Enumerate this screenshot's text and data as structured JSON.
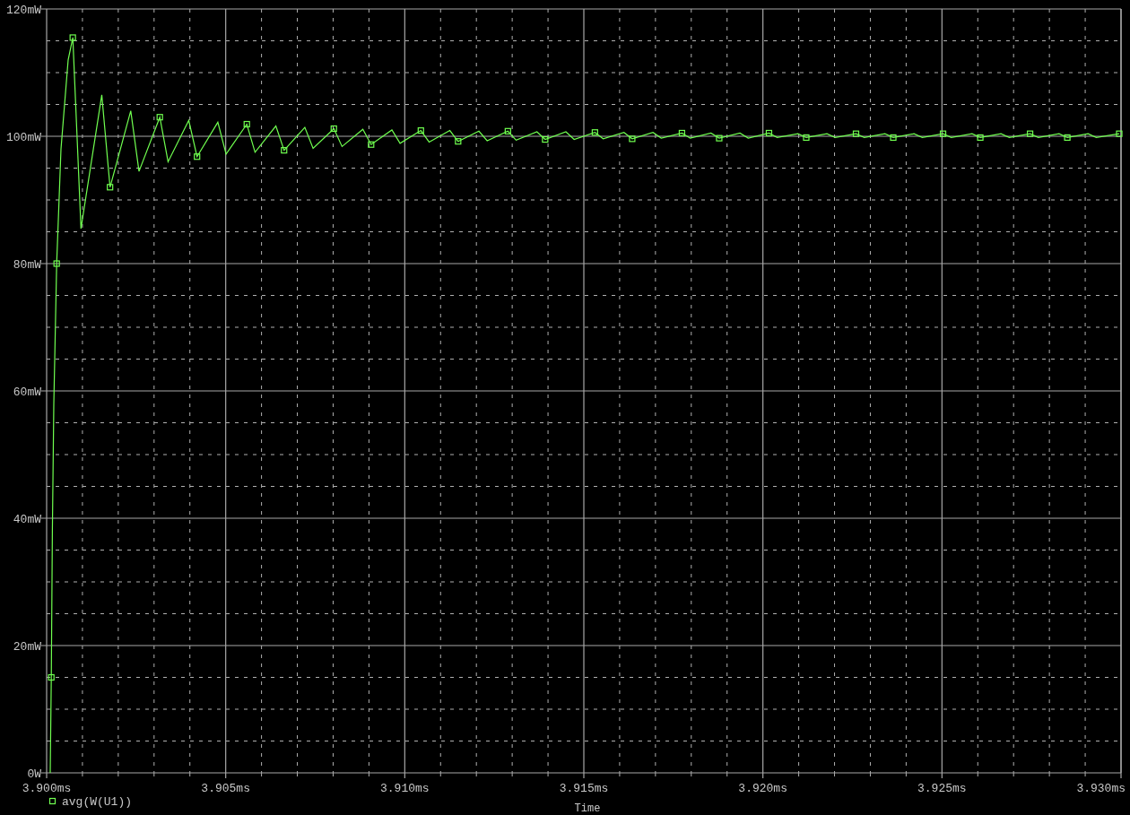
{
  "plot": {
    "chart_data": {
      "type": "line",
      "xlabel": "Time",
      "x": [
        3.9001,
        3.90013,
        3.90016,
        3.9002,
        3.90028,
        3.9004,
        3.9006,
        3.90073,
        3.90096,
        3.90154,
        3.90177,
        3.90235,
        3.90258,
        3.90316,
        3.90339,
        3.90397,
        3.9042,
        3.90478,
        3.90501,
        3.90559,
        3.90582,
        3.9064,
        3.90663,
        3.90721,
        3.90744,
        3.90802,
        3.90825,
        3.90883,
        3.90906,
        3.90964,
        3.90987,
        3.91045,
        3.91068,
        3.91126,
        3.91149,
        3.91207,
        3.9123,
        3.91288,
        3.91311,
        3.91369,
        3.91392,
        3.9145,
        3.91473,
        3.91531,
        3.91554,
        3.91612,
        3.91635,
        3.91693,
        3.91716,
        3.91774,
        3.91797,
        3.91855,
        3.91878,
        3.91936,
        3.91959,
        3.92017,
        3.9204,
        3.92098,
        3.92121,
        3.92179,
        3.92202,
        3.9226,
        3.92283,
        3.92341,
        3.92364,
        3.92422,
        3.92445,
        3.92503,
        3.92526,
        3.92584,
        3.92607,
        3.92665,
        3.92688,
        3.92746,
        3.92769,
        3.92827,
        3.9285,
        3.92908,
        3.92931,
        3.92995
      ],
      "series": [
        {
          "name": "avg(W(U1))",
          "color": "#70ff50",
          "values": [
            0,
            15,
            38,
            58,
            80,
            98,
            112,
            115.5,
            85.5,
            106.5,
            92,
            104,
            94.5,
            103,
            96,
            102.5,
            96.8,
            102.2,
            97.2,
            101.9,
            97.5,
            101.6,
            97.8,
            101.4,
            98.1,
            101.2,
            98.4,
            101.1,
            98.7,
            101,
            98.9,
            100.9,
            99.1,
            100.9,
            99.2,
            100.8,
            99.3,
            100.8,
            99.4,
            100.7,
            99.5,
            100.7,
            99.5,
            100.6,
            99.6,
            100.6,
            99.6,
            100.6,
            99.7,
            100.5,
            99.7,
            100.5,
            99.7,
            100.5,
            99.7,
            100.5,
            99.8,
            100.4,
            99.8,
            100.4,
            99.8,
            100.4,
            99.8,
            100.4,
            99.8,
            100.4,
            99.8,
            100.4,
            99.8,
            100.4,
            99.8,
            100.4,
            99.8,
            100.4,
            99.8,
            100.4,
            99.8,
            100.4,
            99.8,
            100.4
          ]
        }
      ],
      "grid": true,
      "xlim": [
        3.9,
        3.93
      ],
      "ylim": [
        0,
        120
      ],
      "xticks": [
        {
          "value": 3.9,
          "label": "3.900ms"
        },
        {
          "value": 3.905,
          "label": "3.905ms"
        },
        {
          "value": 3.91,
          "label": "3.910ms"
        },
        {
          "value": 3.915,
          "label": "3.915ms"
        },
        {
          "value": 3.92,
          "label": "3.920ms"
        },
        {
          "value": 3.925,
          "label": "3.925ms"
        },
        {
          "value": 3.93,
          "label": "3.930ms"
        }
      ],
      "yticks": [
        {
          "value": 0,
          "label": "0W"
        },
        {
          "value": 20,
          "label": "20mW"
        },
        {
          "value": 40,
          "label": "40mW"
        },
        {
          "value": 60,
          "label": "60mW"
        },
        {
          "value": 80,
          "label": "80mW"
        },
        {
          "value": 100,
          "label": "100mW"
        },
        {
          "value": 120,
          "label": "120mW"
        }
      ]
    }
  }
}
